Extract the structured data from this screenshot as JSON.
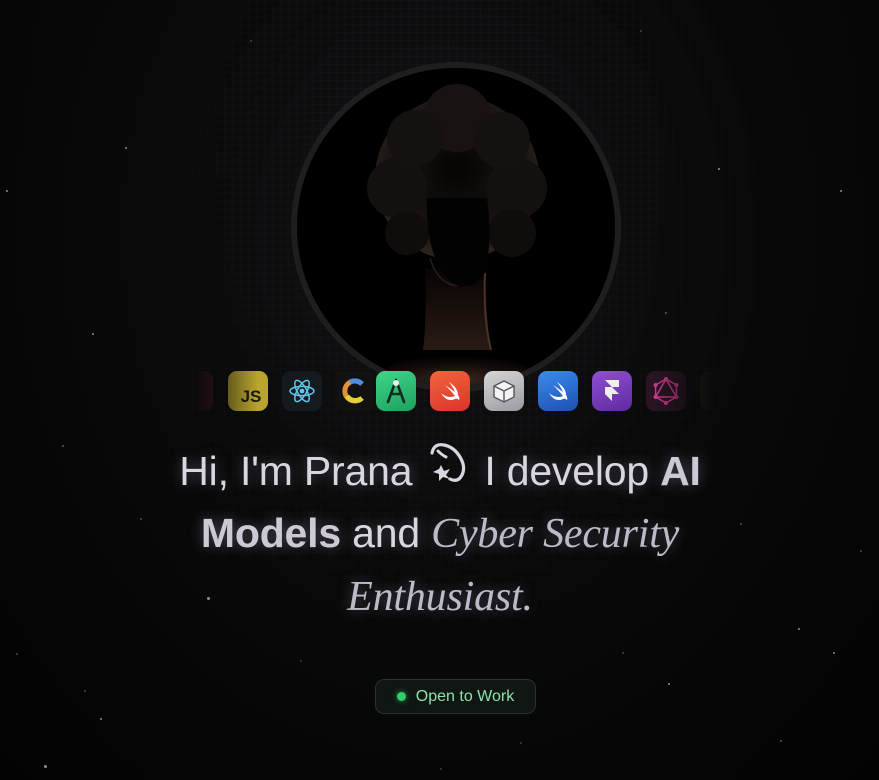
{
  "hero": {
    "greeting": "Hi, I'm Prana",
    "phrase_develop": "I develop",
    "phrase_ai": "AI",
    "phrase_models": "Models",
    "phrase_and": "and",
    "phrase_cyber": "Cyber Security",
    "phrase_enthusiast": "Enthusiast",
    "phrase_period": "."
  },
  "status": {
    "label": "Open to Work",
    "dot_color": "#2fcf6b"
  },
  "tech_icons": [
    {
      "name": "partial-red-icon",
      "color": "#7a1f33"
    },
    {
      "name": "javascript-icon",
      "label": "JS",
      "color": "#c9b43a"
    },
    {
      "name": "react-icon",
      "color": "#5ec8e8"
    },
    {
      "name": "c-language-icon",
      "label": "C",
      "color": "#e0913a"
    },
    {
      "name": "android-studio-icon",
      "color": "#2fbe7a"
    },
    {
      "name": "swift-icon",
      "color": "#ea5238"
    },
    {
      "name": "box-icon",
      "color": "#b8b8bc"
    },
    {
      "name": "swiftui-icon",
      "color": "#2b6fd6"
    },
    {
      "name": "framer-icon",
      "color": "#7e3fc4"
    },
    {
      "name": "graphql-icon",
      "color": "#d23a8f"
    },
    {
      "name": "partial-olive-icon",
      "color": "#3a3a1a"
    }
  ],
  "colors": {
    "background": "#050505",
    "headline_text": "#d9d6e0",
    "status_text": "#8fe0ad"
  }
}
